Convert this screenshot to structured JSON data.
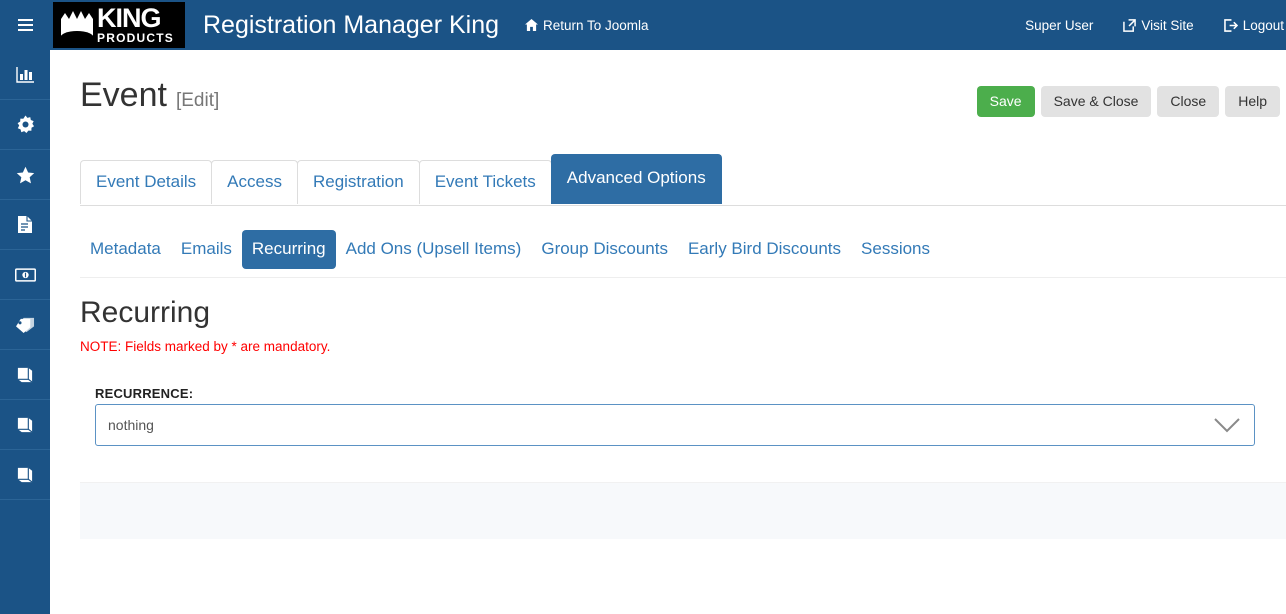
{
  "header": {
    "menu_icon": "hamburger-icon",
    "logo": {
      "crown_icon": "crown-icon",
      "brand_main": "KING",
      "brand_sub": "PRODUCTS"
    },
    "app_title": "Registration Manager King",
    "return_link": {
      "icon": "home-icon",
      "label": "Return To Joomla"
    },
    "user_name": "Super User",
    "visit_site": {
      "icon": "external-link-icon",
      "label": "Visit Site"
    },
    "logout": {
      "icon": "sign-out-icon",
      "label": "Logout"
    }
  },
  "sidebar": {
    "items": [
      {
        "icon": "chart-bar-icon",
        "name": "sidebar-item-dashboard"
      },
      {
        "icon": "gear-icon",
        "name": "sidebar-item-settings"
      },
      {
        "icon": "star-icon",
        "name": "sidebar-item-featured"
      },
      {
        "icon": "file-invoice-icon",
        "name": "sidebar-item-invoices"
      },
      {
        "icon": "money-bill-icon",
        "name": "sidebar-item-payments"
      },
      {
        "icon": "tags-icon",
        "name": "sidebar-item-tags"
      },
      {
        "icon": "book-icon",
        "name": "sidebar-item-book-1"
      },
      {
        "icon": "book-icon",
        "name": "sidebar-item-book-2"
      },
      {
        "icon": "book-icon",
        "name": "sidebar-item-book-3"
      }
    ]
  },
  "page": {
    "title": "Event",
    "edit_tag": "[Edit]"
  },
  "toolbar": {
    "save_label": "Save",
    "save_close_label": "Save & Close",
    "close_label": "Close",
    "help_label": "Help"
  },
  "tabs": [
    {
      "label": "Event Details",
      "active": false
    },
    {
      "label": "Access",
      "active": false
    },
    {
      "label": "Registration",
      "active": false
    },
    {
      "label": "Event Tickets",
      "active": false
    },
    {
      "label": "Advanced Options",
      "active": true
    }
  ],
  "subtabs": [
    {
      "label": "Metadata",
      "active": false
    },
    {
      "label": "Emails",
      "active": false
    },
    {
      "label": "Recurring",
      "active": true
    },
    {
      "label": "Add Ons (Upsell Items)",
      "active": false
    },
    {
      "label": "Group Discounts",
      "active": false
    },
    {
      "label": "Early Bird Discounts",
      "active": false
    },
    {
      "label": "Sessions",
      "active": false
    }
  ],
  "section": {
    "heading": "Recurring",
    "note": "NOTE: Fields marked by * are mandatory."
  },
  "form": {
    "recurrence_label": "RECURRENCE:",
    "recurrence_value": "nothing",
    "recurrence_chevron_icon": "chevron-down-icon"
  },
  "colors": {
    "header_blue": "#1b5386",
    "active_tab_blue": "#2e6da4",
    "save_green": "#4cae4c",
    "link_blue": "#337ab7",
    "note_red": "#ff0000",
    "panel_gray": "#f7f9fb"
  }
}
